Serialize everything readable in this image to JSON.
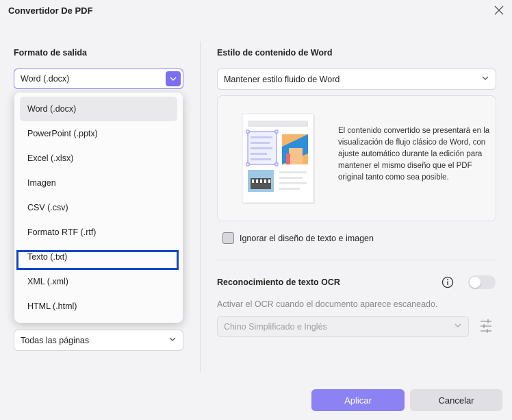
{
  "window": {
    "title": "Convertidor De PDF"
  },
  "left": {
    "output_format_label": "Formato de salida",
    "output_format_value": "Word (.docx)",
    "format_options": [
      "Word (.docx)",
      "PowerPoint (.pptx)",
      "Excel (.xlsx)",
      "Imagen",
      "CSV (.csv)",
      "Formato RTF (.rtf)",
      "Texto (.txt)",
      "XML (.xml)",
      "HTML (.html)"
    ],
    "page_range_value": "Todas las páginas"
  },
  "right": {
    "word_style_label": "Estilo de contenido de Word",
    "word_style_value": "Mantener estilo fluido de Word",
    "preview_description": "El contenido convertido se presentará en la visualización de flujo clásico de Word, con ajuste automático durante la edición para mantener el mismo diseño que el PDF original tanto como sea posible.",
    "ignore_layout_label": "Ignorar el diseño de texto e imagen",
    "ocr_label": "Reconocimiento de texto OCR",
    "ocr_help": "Activar el OCR cuando el documento aparece escaneado.",
    "ocr_language_value": "Chino Simplificado e Inglés"
  },
  "buttons": {
    "apply": "Aplicar",
    "cancel": "Cancelar"
  },
  "colors": {
    "accent": "#7a6ff0",
    "primary_button": "#8c82f4",
    "highlight": "#1246c8"
  }
}
